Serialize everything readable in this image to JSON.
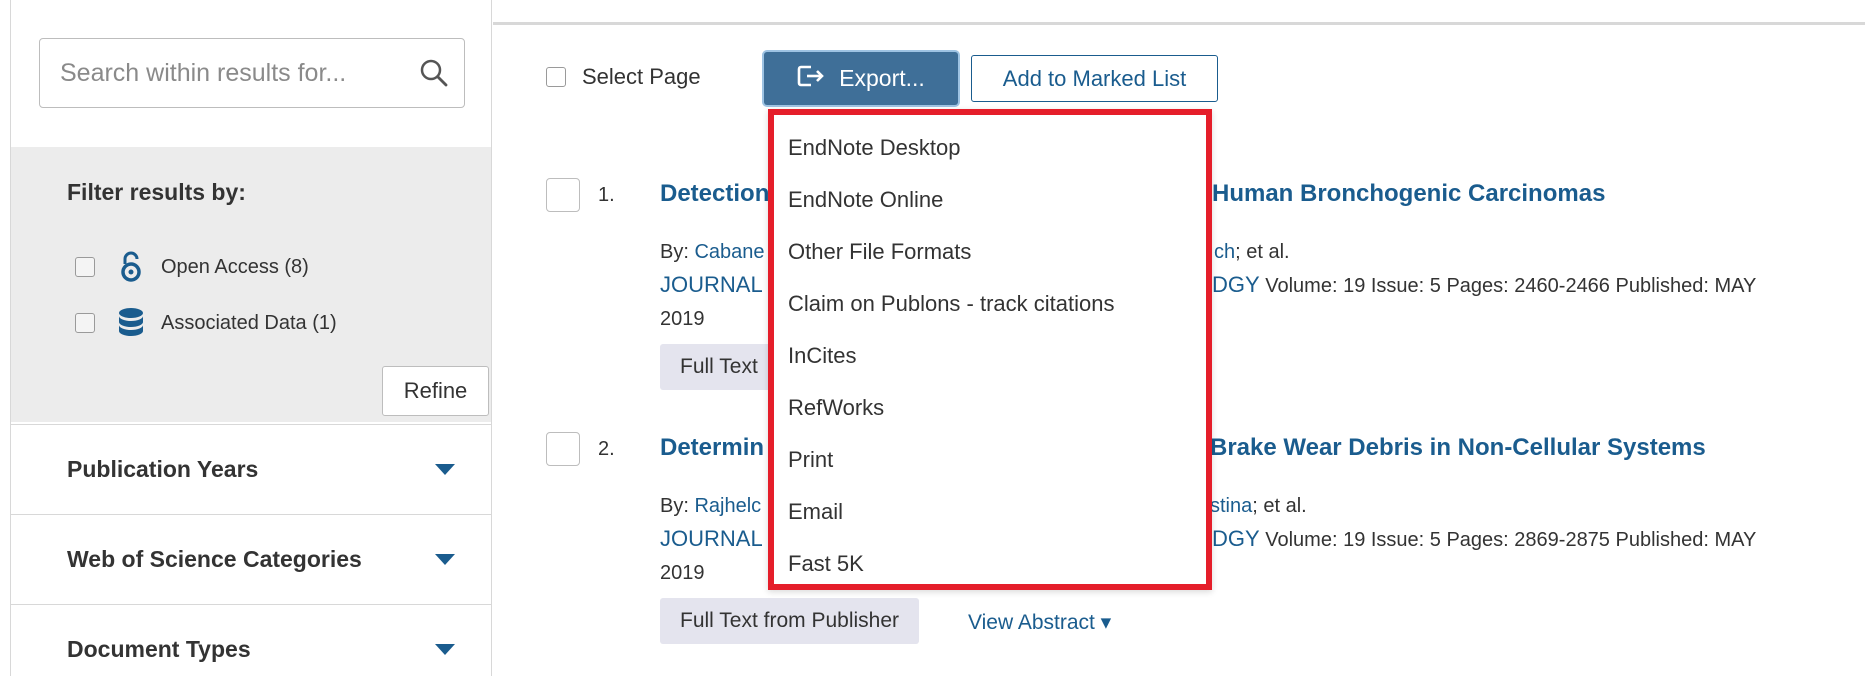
{
  "search": {
    "placeholder": "Search within results for..."
  },
  "filter": {
    "title": "Filter results by:",
    "items": [
      {
        "label": "Open Access (8)"
      },
      {
        "label": "Associated Data (1)"
      }
    ],
    "refine_label": "Refine"
  },
  "facets": [
    {
      "label": "Publication Years"
    },
    {
      "label": "Web of Science Categories"
    },
    {
      "label": "Document Types"
    }
  ],
  "toolbar": {
    "select_page_label": "Select Page",
    "export_label": "Export...",
    "marked_list_label": "Add to Marked List"
  },
  "export_menu": {
    "items": [
      "EndNote Desktop",
      "EndNote Online",
      "Other File Formats",
      "Claim on Publons - track citations",
      "InCites",
      "RefWorks",
      "Print",
      "Email",
      "Fast 5K"
    ]
  },
  "results": [
    {
      "number": "1.",
      "title_start": "Detection",
      "title_end": "Human Bronchogenic Carcinomas",
      "by_prefix": "By: ",
      "author_start": "Cabane",
      "author_end": "ch",
      "et_al": "; et al.",
      "journal_start": "JOURNAL",
      "journal_end": "DGY",
      "details": " Volume: 19  Issue: 5  Pages: 2460-2466  Published: MAY",
      "year": "2019",
      "full_text": "Full Text",
      "view_abstract": ""
    },
    {
      "number": "2.",
      "title_start": "Determin",
      "title_end": "Brake Wear Debris in Non-Cellular Systems",
      "by_prefix": "By: ",
      "author_start": "Rajhelc",
      "author_end": "stina",
      "et_al": "; et al.",
      "journal_start": "JOURNAL",
      "journal_end": "DGY",
      "details": " Volume: 19  Issue: 5  Pages: 2869-2875  Published: MAY",
      "year": "2019",
      "full_text": "Full Text from Publisher",
      "view_abstract": "View Abstract ▾"
    }
  ],
  "colors": {
    "link": "#1a5c8e",
    "export_bg": "#3f6f98",
    "highlight": "#e51e2a",
    "panel_bg": "#ececec"
  }
}
